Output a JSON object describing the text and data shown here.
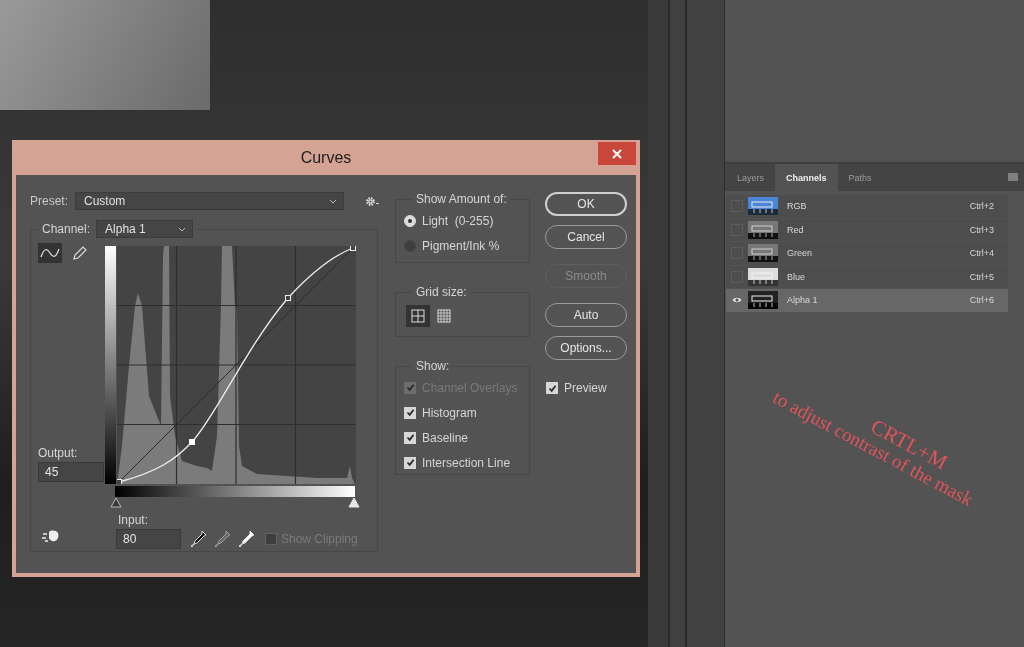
{
  "dialog": {
    "title": "Curves",
    "preset": {
      "label": "Preset:",
      "value": "Custom"
    },
    "channel": {
      "label": "Channel:",
      "value": "Alpha 1"
    },
    "tools": [
      {
        "kind": "curve",
        "selected": true
      },
      {
        "kind": "pencil",
        "selected": false
      }
    ],
    "output": {
      "label": "Output:",
      "value": "45"
    },
    "input": {
      "label": "Input:",
      "value": "80"
    },
    "input_sliders": [
      {
        "level": 0
      },
      {
        "level": 1
      }
    ],
    "show_clipping": {
      "label": "Show Clipping",
      "checked": false,
      "disabled": true
    },
    "show_amount": {
      "title": "Show Amount of:",
      "options": [
        {
          "label": "Light  (0-255)",
          "selected": true
        },
        {
          "label": "Pigment/Ink %",
          "selected": false
        }
      ]
    },
    "grid_size": {
      "title": "Grid size:",
      "options": [
        {
          "kind": "simple",
          "selected": true
        },
        {
          "kind": "detailed",
          "selected": false
        }
      ]
    },
    "show": {
      "title": "Show:",
      "options": [
        {
          "label": "Channel Overlays",
          "checked": true,
          "disabled": true
        },
        {
          "label": "Histogram",
          "checked": true,
          "disabled": false
        },
        {
          "label": "Baseline",
          "checked": true,
          "disabled": false
        },
        {
          "label": "Intersection Line",
          "checked": true,
          "disabled": false
        }
      ]
    },
    "buttons": [
      {
        "label": "OK",
        "default": true,
        "disabled": false
      },
      {
        "label": "Cancel",
        "default": false,
        "disabled": false
      },
      {
        "label": "Smooth",
        "default": false,
        "disabled": true
      },
      {
        "label": "Auto",
        "default": false,
        "disabled": false
      },
      {
        "label": "Options...",
        "default": false,
        "disabled": false
      }
    ],
    "preview": {
      "label": "Preview",
      "checked": true
    }
  },
  "panel": {
    "tabs": [
      {
        "label": "Layers",
        "selected": false
      },
      {
        "label": "Channels",
        "selected": true
      },
      {
        "label": "Paths",
        "selected": false
      }
    ],
    "channels": [
      {
        "name": "RGB",
        "shortcut": "Ctrl+2",
        "kind": "color",
        "visible": false,
        "selected": false
      },
      {
        "name": "Red",
        "shortcut": "Ctrl+3",
        "kind": "gray",
        "visible": false,
        "selected": false
      },
      {
        "name": "Green",
        "shortcut": "Ctrl+4",
        "kind": "gray",
        "visible": false,
        "selected": false
      },
      {
        "name": "Blue",
        "shortcut": "Ctrl+5",
        "kind": "light",
        "visible": false,
        "selected": false
      },
      {
        "name": "Alpha 1",
        "shortcut": "Ctrl+6",
        "kind": "mask",
        "visible": true,
        "selected": true
      }
    ]
  },
  "annotation": {
    "title": "CRTL+M",
    "text": "to adjust contrast of the mask"
  }
}
